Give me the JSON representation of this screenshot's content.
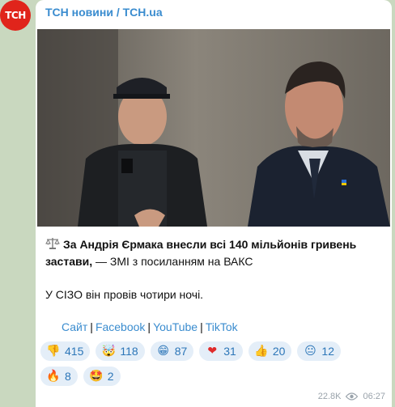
{
  "channel": {
    "avatar_text": "ТСН",
    "name": "ТСН новини / TCH.ua"
  },
  "post": {
    "headline_icon": "scales-icon",
    "headline_bold": "За Андрія Єрмака внесли всі 140 мільйонів гривень застави,",
    "headline_rest": " — ЗМІ з посиланням на ВАКС",
    "paragraph": "У СІЗО він провів чотири ночі."
  },
  "links": [
    {
      "label": "Сайт"
    },
    {
      "label": "Facebook"
    },
    {
      "label": "YouTube"
    },
    {
      "label": "TikTok"
    }
  ],
  "reactions": [
    {
      "emoji": "👎",
      "icon": "thumbs-down-icon",
      "count": "415"
    },
    {
      "emoji": "🤯",
      "icon": "mind-blown-icon",
      "count": "118"
    },
    {
      "emoji": "😁",
      "icon": "grin-icon",
      "count": "87"
    },
    {
      "emoji": "❤",
      "icon": "heart-icon",
      "count": "31"
    },
    {
      "emoji": "👍",
      "icon": "thumbs-up-icon",
      "count": "20"
    },
    {
      "emoji": "😐",
      "icon": "neutral-face-icon",
      "count": "12"
    },
    {
      "emoji": "🔥",
      "icon": "fire-icon",
      "count": "8"
    },
    {
      "emoji": "🤩",
      "icon": "star-eyes-icon",
      "count": "2"
    }
  ],
  "meta": {
    "views": "22.8K",
    "time": "06:27"
  },
  "colors": {
    "accent": "#3a8ccf",
    "avatar_bg": "#e0241b",
    "reaction_bg": "#e4eef8",
    "chat_bg": "#c9d8bf"
  }
}
